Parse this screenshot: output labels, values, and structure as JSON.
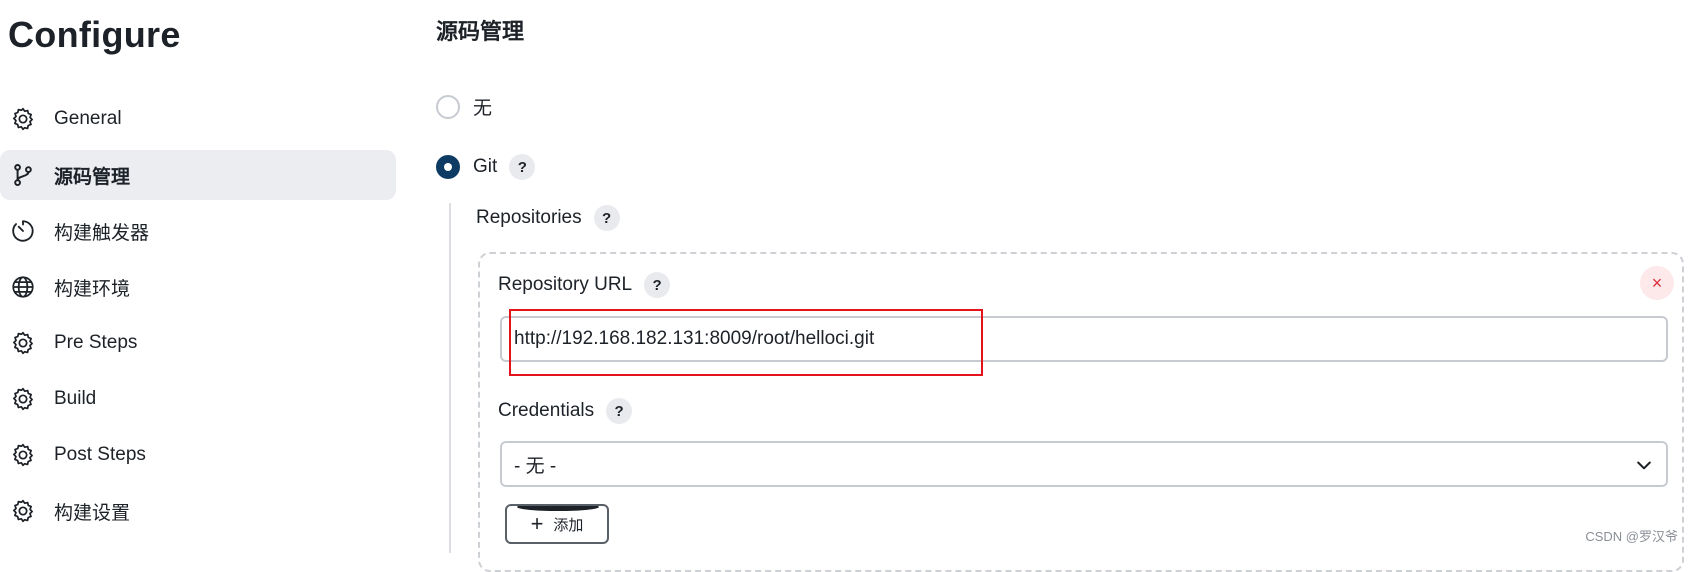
{
  "sidebar": {
    "title": "Configure",
    "items": [
      {
        "label": "General",
        "icon": "gear-icon",
        "active": false
      },
      {
        "label": "源码管理",
        "icon": "git-branch-icon",
        "active": true
      },
      {
        "label": "构建触发器",
        "icon": "timer-icon",
        "active": false
      },
      {
        "label": "构建环境",
        "icon": "globe-icon",
        "active": false
      },
      {
        "label": "Pre Steps",
        "icon": "gear-icon",
        "active": false
      },
      {
        "label": "Build",
        "icon": "gear-icon",
        "active": false
      },
      {
        "label": "Post Steps",
        "icon": "gear-icon",
        "active": false
      },
      {
        "label": "构建设置",
        "icon": "gear-icon",
        "active": false
      }
    ]
  },
  "scm": {
    "title": "源码管理",
    "options": [
      {
        "label": "无",
        "checked": false
      },
      {
        "label": "Git",
        "checked": true
      }
    ],
    "help_glyph": "?",
    "repositories_label": "Repositories",
    "repo_url_label": "Repository URL",
    "repo_url_value": "http://192.168.182.131:8009/root/helloci.git",
    "credentials_label": "Credentials",
    "credentials_value": "- 无 -",
    "add_button_label": "添加",
    "close_glyph": "×"
  },
  "colors": {
    "accent": "#0e3b63",
    "active_bg": "#ecedf1",
    "highlight": "#e3121b",
    "close": "#e02e3c"
  },
  "watermark": "CSDN @罗汉爷"
}
